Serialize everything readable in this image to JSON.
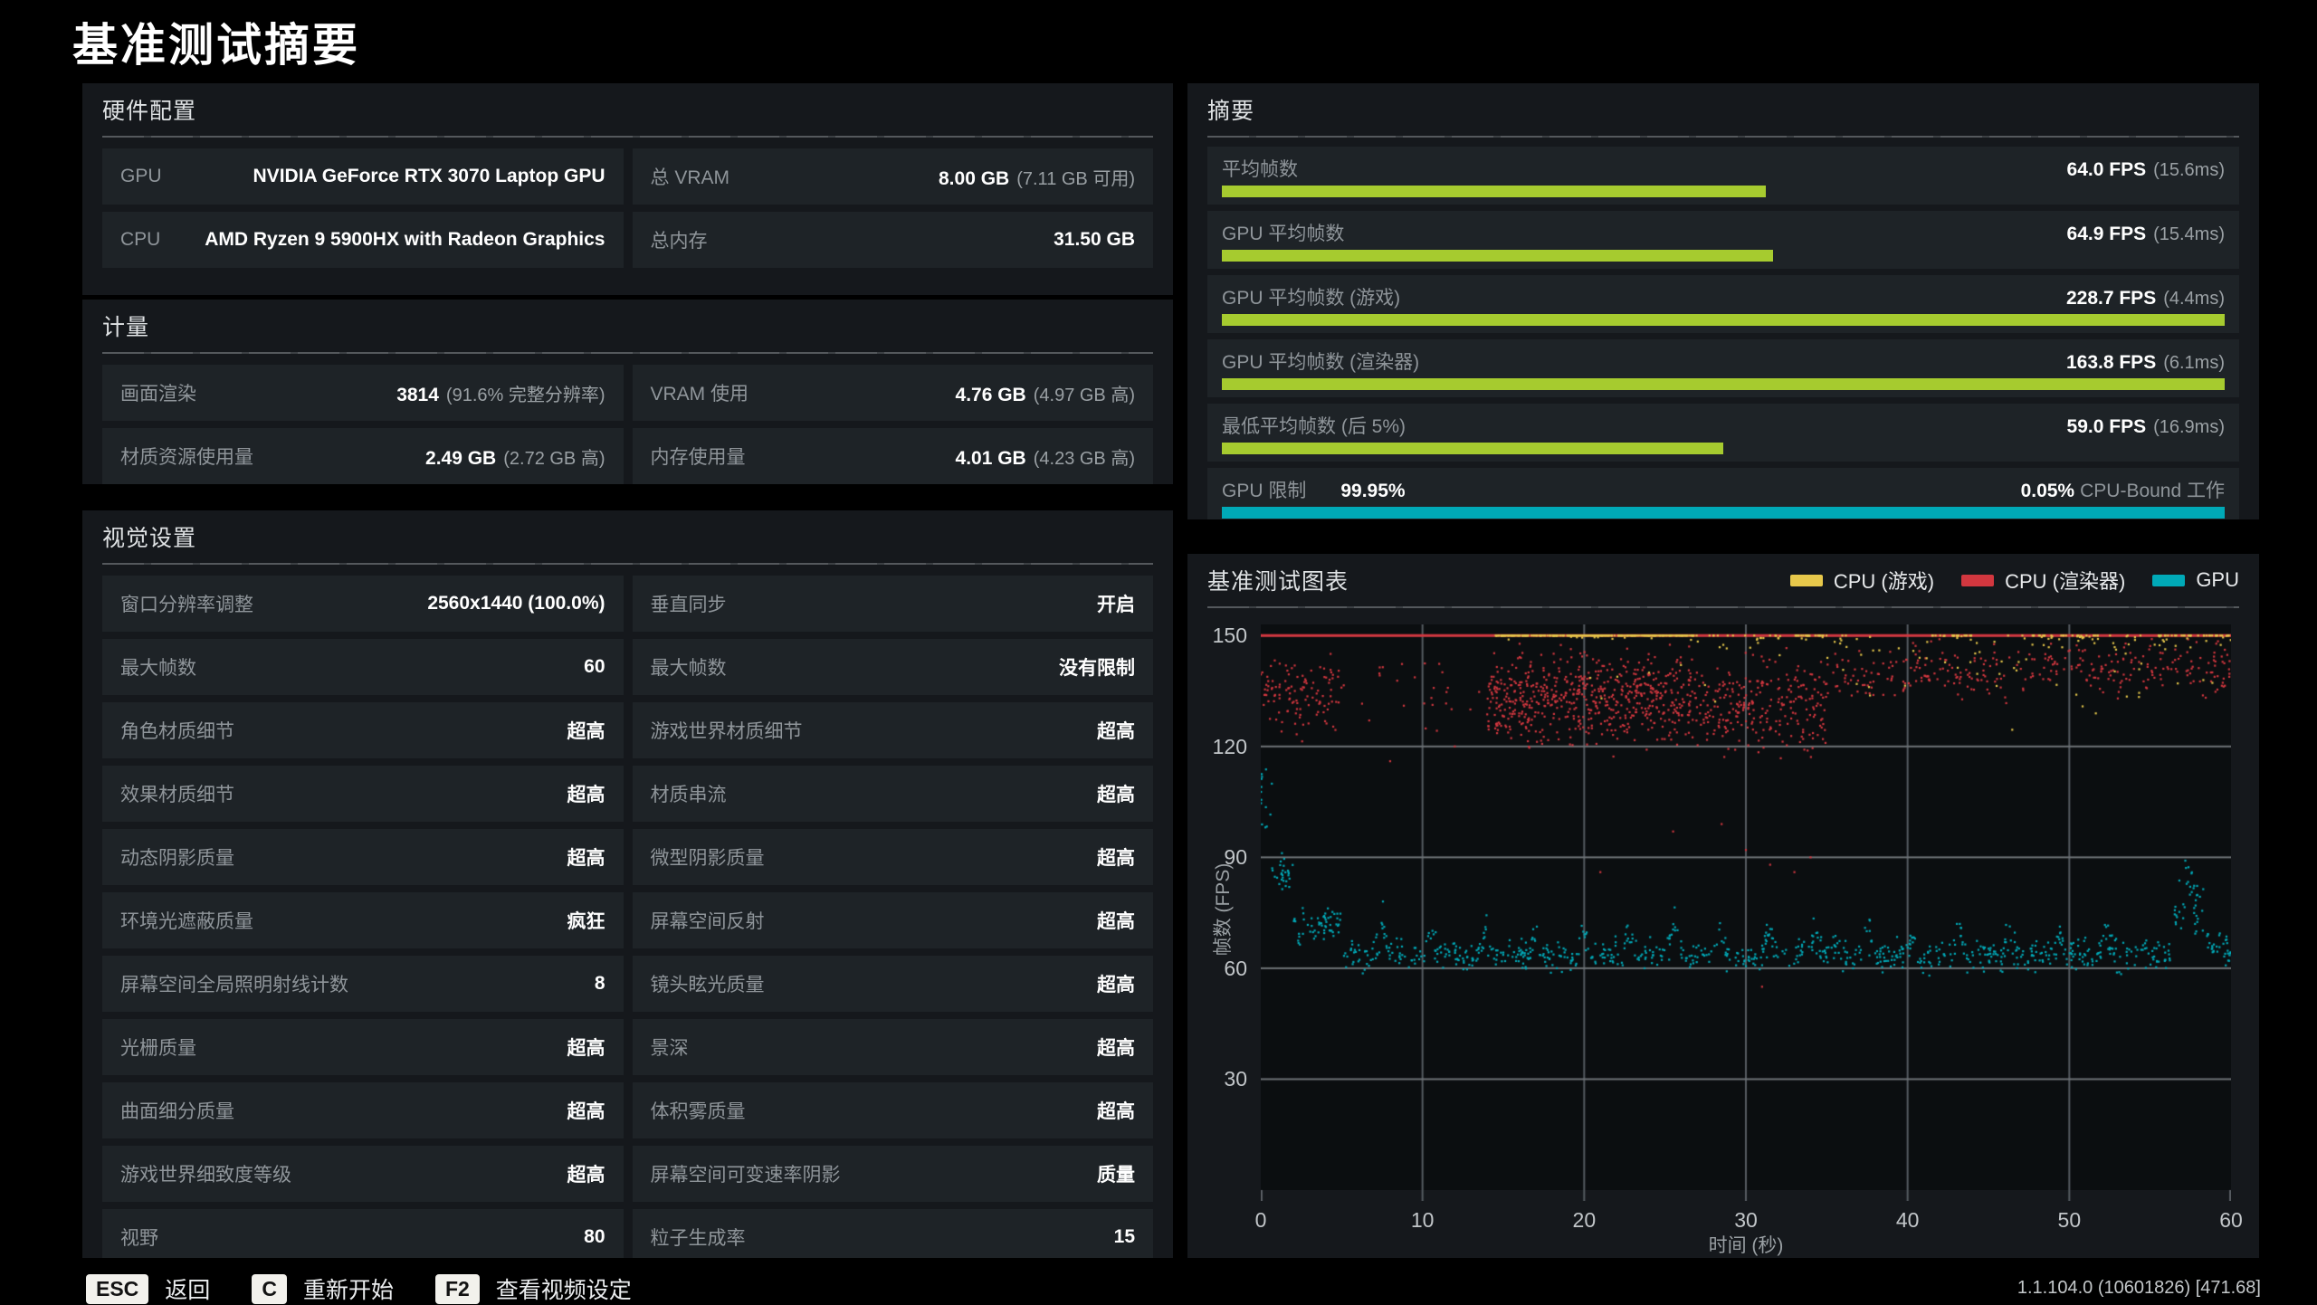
{
  "page": {
    "title": "基准测试摘要",
    "version": "1.1.104.0 (10601826) [471.68]"
  },
  "hardware": {
    "title": "硬件配置",
    "rows": [
      {
        "label": "GPU",
        "value": "NVIDIA GeForce RTX 3070 Laptop GPU",
        "note": ""
      },
      {
        "label": "总 VRAM",
        "value": "8.00 GB",
        "note": "(7.11 GB 可用)"
      },
      {
        "label": "CPU",
        "value": "AMD Ryzen 9 5900HX with Radeon Graphics",
        "note": ""
      },
      {
        "label": "总内存",
        "value": "31.50 GB",
        "note": ""
      }
    ]
  },
  "metrics": {
    "title": "计量",
    "rows": [
      {
        "label": "画面渲染",
        "value": "3814",
        "note": "(91.6% 完整分辨率)"
      },
      {
        "label": "VRAM 使用",
        "value": "4.76 GB",
        "note": "(4.97 GB 高)"
      },
      {
        "label": "材质资源使用量",
        "value": "2.49 GB",
        "note": "(2.72 GB 高)"
      },
      {
        "label": "内存使用量",
        "value": "4.01 GB",
        "note": "(4.23 GB 高)"
      }
    ]
  },
  "visual": {
    "title": "视觉设置",
    "rows": [
      {
        "label": "窗口分辨率调整",
        "value": "2560x1440 (100.0%)"
      },
      {
        "label": "垂直同步",
        "value": "开启"
      },
      {
        "label": "最大帧数",
        "value": "60"
      },
      {
        "label": "最大帧数",
        "value": "没有限制"
      },
      {
        "label": "角色材质细节",
        "value": "超高"
      },
      {
        "label": "游戏世界材质细节",
        "value": "超高"
      },
      {
        "label": "效果材质细节",
        "value": "超高"
      },
      {
        "label": "材质串流",
        "value": "超高"
      },
      {
        "label": "动态阴影质量",
        "value": "超高"
      },
      {
        "label": "微型阴影质量",
        "value": "超高"
      },
      {
        "label": "环境光遮蔽质量",
        "value": "疯狂"
      },
      {
        "label": "屏幕空间反射",
        "value": "超高"
      },
      {
        "label": "屏幕空间全局照明射线计数",
        "value": "8"
      },
      {
        "label": "镜头眩光质量",
        "value": "超高"
      },
      {
        "label": "光栅质量",
        "value": "超高"
      },
      {
        "label": "景深",
        "value": "超高"
      },
      {
        "label": "曲面细分质量",
        "value": "超高"
      },
      {
        "label": "体积雾质量",
        "value": "超高"
      },
      {
        "label": "游戏世界细致度等级",
        "value": "超高"
      },
      {
        "label": "屏幕空间可变速率阴影",
        "value": "质量"
      },
      {
        "label": "视野",
        "value": "80"
      },
      {
        "label": "粒子生成率",
        "value": "15"
      }
    ]
  },
  "summary": {
    "title": "摘要",
    "bar_color": "#a6cb2f",
    "rows": [
      {
        "label": "平均帧数",
        "value": "64.0 FPS",
        "note": "(15.6ms)",
        "bar_pct": 54.2,
        "bar_color": "#a6cb2f"
      },
      {
        "label": "GPU 平均帧数",
        "value": "64.9 FPS",
        "note": "(15.4ms)",
        "bar_pct": 55.0,
        "bar_color": "#a6cb2f"
      },
      {
        "label": "GPU 平均帧数 (游戏)",
        "value": "228.7 FPS",
        "note": "(4.4ms)",
        "bar_pct": 100,
        "bar_color": "#a6cb2f"
      },
      {
        "label": "GPU 平均帧数 (渲染器)",
        "value": "163.8 FPS",
        "note": "(6.1ms)",
        "bar_pct": 100,
        "bar_color": "#a6cb2f"
      },
      {
        "label": "最低平均帧数 (后 5%)",
        "value": "59.0 FPS",
        "note": "(16.9ms)",
        "bar_pct": 50.0,
        "bar_color": "#a6cb2f"
      }
    ],
    "gpu_bound": {
      "label": "GPU 限制",
      "gpu_pct": "99.95%",
      "cpu_pct": "0.05%",
      "cpu_label": "CPU-Bound 工作",
      "bar_pct": 100,
      "bar_color": "#00a9b7"
    }
  },
  "chart_data": {
    "type": "scatter",
    "title": "基准测试图表",
    "xlabel": "时间 (秒)",
    "ylabel": "帧数 (FPS)",
    "x_ticks": [
      0,
      10,
      20,
      30,
      40,
      50,
      60
    ],
    "y_ticks": [
      30,
      60,
      90,
      120,
      150
    ],
    "x_max": 60,
    "y_max": 153,
    "cap": 150,
    "cap_line_color": "#d2373f",
    "grid_color_h": "#6d7276",
    "grid_color_v": "#565b60",
    "series": [
      {
        "name": "CPU (游戏)",
        "color": "#e7c84b",
        "segments": [
          {
            "t0": 14.5,
            "t1": 27,
            "n": 270,
            "base": 153,
            "amp": 4
          },
          {
            "t0": 27,
            "t1": 33,
            "n": 26,
            "base": 149,
            "amp": 5
          },
          {
            "t0": 33,
            "t1": 35,
            "n": 26,
            "base": 152,
            "amp": 3
          },
          {
            "t0": 35,
            "t1": 41.5,
            "n": 18,
            "base": 147,
            "amp": 6
          },
          {
            "t0": 41.5,
            "t1": 44,
            "n": 28,
            "base": 151,
            "amp": 4
          },
          {
            "t0": 44,
            "t1": 47.5,
            "n": 14,
            "base": 146,
            "amp": 7
          },
          {
            "t0": 47.5,
            "t1": 52,
            "n": 42,
            "base": 151,
            "amp": 4
          },
          {
            "t0": 52,
            "t1": 55.5,
            "n": 14,
            "base": 147,
            "amp": 6
          },
          {
            "t0": 55.5,
            "t1": 60,
            "n": 48,
            "base": 151,
            "amp": 5
          },
          {
            "t0": 20,
            "t1": 60,
            "n": 28,
            "base": 136,
            "amp": 10
          }
        ]
      },
      {
        "name": "CPU (渲染器)",
        "color": "#d2373f",
        "segments": [
          {
            "t0": 0,
            "t1": 1.2,
            "n": 30,
            "base": 136,
            "amp": 11
          },
          {
            "t0": 1.2,
            "t1": 5,
            "n": 85,
            "base": 133,
            "amp": 11
          },
          {
            "t0": 5,
            "t1": 14,
            "n": 26,
            "base": 133,
            "amp": 13
          },
          {
            "t0": 14,
            "t1": 27,
            "n": 640,
            "base": 133,
            "amp": 13
          },
          {
            "t0": 27,
            "t1": 35,
            "n": 260,
            "base": 131,
            "amp": 13
          },
          {
            "t0": 35,
            "t1": 47,
            "n": 150,
            "base": 140,
            "amp": 8
          },
          {
            "t0": 47,
            "t1": 60,
            "n": 175,
            "base": 141,
            "amp": 8
          }
        ],
        "outliers": [
          [
            21,
            86
          ],
          [
            25.5,
            97
          ],
          [
            30,
            92
          ],
          [
            31.5,
            88
          ],
          [
            33,
            86
          ],
          [
            31,
            55
          ],
          [
            8,
            116
          ],
          [
            12,
            120
          ],
          [
            28.5,
            99
          ],
          [
            34,
            90
          ]
        ]
      },
      {
        "name": "GPU",
        "color": "#00a9b7",
        "segments": [
          {
            "t0": 0,
            "t1": 0.7,
            "n": 14,
            "base": 106,
            "amp": 10
          },
          {
            "t0": 0.7,
            "t1": 2,
            "n": 28,
            "base": 84,
            "amp": 7
          },
          {
            "t0": 2,
            "t1": 5,
            "n": 58,
            "base": 71,
            "amp": 5
          },
          {
            "t0": 5,
            "t1": 56.5,
            "n": 840,
            "base": 63.5,
            "amp": 4.5
          },
          {
            "t0": 56.5,
            "t1": 58.5,
            "n": 42,
            "base": 76,
            "amp": 9
          },
          {
            "t0": 58.5,
            "t1": 60,
            "n": 32,
            "base": 66,
            "amp": 5
          }
        ],
        "spikes": [
          [
            7.5,
            11
          ],
          [
            10.5,
            9
          ],
          [
            13.8,
            8
          ],
          [
            17,
            7
          ],
          [
            20,
            8
          ],
          [
            22.7,
            9
          ],
          [
            25.6,
            10
          ],
          [
            28.4,
            8
          ],
          [
            31.4,
            9
          ],
          [
            34.3,
            10
          ],
          [
            37.6,
            9
          ],
          [
            40.3,
            7
          ],
          [
            43.2,
            8
          ],
          [
            46.3,
            9
          ],
          [
            49.4,
            8
          ],
          [
            52.3,
            9
          ],
          [
            57.3,
            14
          ]
        ]
      }
    ]
  },
  "actions": [
    {
      "key": "ESC",
      "label": "返回"
    },
    {
      "key": "C",
      "label": "重新开始"
    },
    {
      "key": "F2",
      "label": "查看视频设定"
    }
  ]
}
